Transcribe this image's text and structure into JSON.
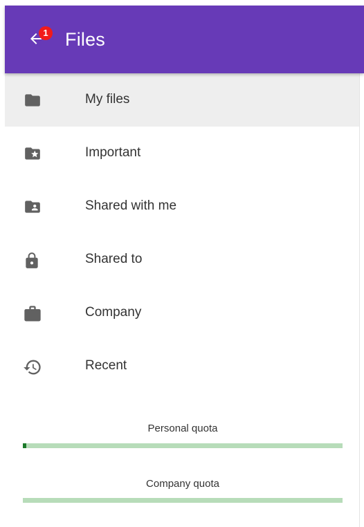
{
  "appbar": {
    "title": "Files",
    "back_icon": "arrow-left-icon",
    "notification_count": "1",
    "color": "#673ab7",
    "badge_color": "#f21a1a"
  },
  "nav": {
    "items": [
      {
        "label": "My files",
        "icon": "folder-icon",
        "selected": true
      },
      {
        "label": "Important",
        "icon": "folder-star-icon",
        "selected": false
      },
      {
        "label": "Shared with me",
        "icon": "folder-shared-icon",
        "selected": false
      },
      {
        "label": "Shared to",
        "icon": "lock-icon",
        "selected": false
      },
      {
        "label": "Company",
        "icon": "briefcase-icon",
        "selected": false
      },
      {
        "label": "Recent",
        "icon": "history-icon",
        "selected": false
      }
    ],
    "selected_bg": "#eeeeee",
    "icon_color": "#616161"
  },
  "quota": {
    "personal": {
      "label": "Personal quota",
      "used_fraction": 0.01
    },
    "company": {
      "label": "Company quota",
      "used_fraction": 0.0
    },
    "track_color": "#b7dcb9",
    "fill_color": "#1b7a2a"
  }
}
